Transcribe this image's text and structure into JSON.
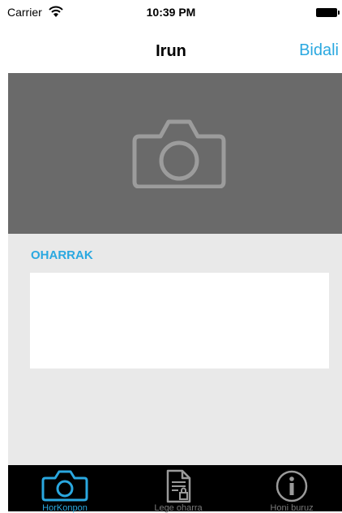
{
  "status_bar": {
    "carrier": "Carrier",
    "time": "10:39 PM"
  },
  "nav": {
    "title": "Irun",
    "right_button": "Bidali"
  },
  "notes": {
    "label": "OHARRAK",
    "value": "",
    "placeholder": ""
  },
  "tabs": [
    {
      "label": "HorKonpon",
      "icon": "camera-icon",
      "active": true
    },
    {
      "label": "Lege oharra",
      "icon": "document-lock-icon",
      "active": false
    },
    {
      "label": "Honi buruz",
      "icon": "info-icon",
      "active": false
    }
  ],
  "colors": {
    "accent": "#2aa8e0",
    "photo_bg": "#6a6a6a",
    "content_bg": "#e9e9e9",
    "tab_bar_bg": "#000000"
  }
}
